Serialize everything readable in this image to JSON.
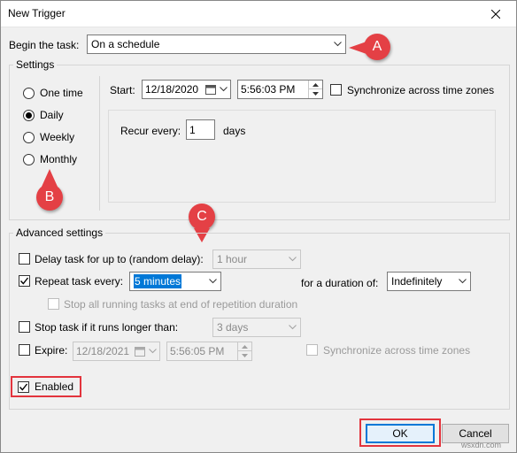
{
  "window": {
    "title": "New Trigger"
  },
  "begin": {
    "label": "Begin the task:",
    "value": "On a schedule"
  },
  "settings": {
    "group_title": "Settings",
    "radios": [
      {
        "label": "One time",
        "selected": false
      },
      {
        "label": "Daily",
        "selected": true
      },
      {
        "label": "Weekly",
        "selected": false
      },
      {
        "label": "Monthly",
        "selected": false
      }
    ],
    "start_label": "Start:",
    "start_date": "12/18/2020",
    "start_time": "5:56:03 PM",
    "sync_label": "Synchronize across time zones",
    "recur_label": "Recur every:",
    "recur_value": "1",
    "recur_unit": "days"
  },
  "advanced": {
    "group_title": "Advanced settings",
    "delay_label": "Delay task for up to (random delay):",
    "delay_value": "1 hour",
    "repeat_label": "Repeat task every:",
    "repeat_value": "5 minutes",
    "duration_label": "for a duration of:",
    "duration_value": "Indefinitely",
    "stop_running_label": "Stop all running tasks at end of repetition duration",
    "stop_longer_label": "Stop task if it runs longer than:",
    "stop_longer_value": "3 days",
    "expire_label": "Expire:",
    "expire_date": "12/18/2021",
    "expire_time": "5:56:05 PM",
    "expire_sync_label": "Synchronize across time zones",
    "enabled_label": "Enabled"
  },
  "buttons": {
    "ok": "OK",
    "cancel": "Cancel"
  },
  "markers": {
    "a": "A",
    "b": "B",
    "c": "C"
  },
  "watermark": "wsxdn.com"
}
